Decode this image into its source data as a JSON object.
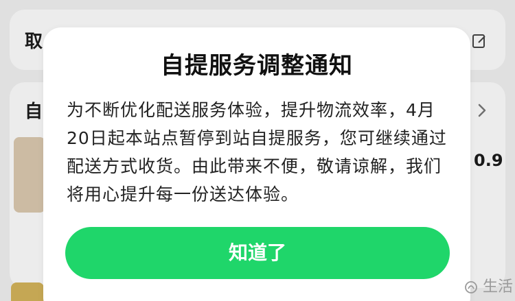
{
  "background": {
    "cancel_label_partial": "取",
    "self_label_partial": "自",
    "price_partial": "0.9",
    "icons": [
      "edit-icon",
      "chevron-right-icon"
    ]
  },
  "modal": {
    "title": "自提服务调整通知",
    "body": "为不断优化配送服务体验，提升物流效率，4月20日起本站点暂停到站自提服务，您可继续通过配送方式收货。由此带来不便，敬请谅解，我们将用心提升每一份送达体验。",
    "confirm_label": "知道了"
  },
  "watermark": {
    "text": "生活"
  },
  "colors": {
    "accent_green": "#1fd66a",
    "modal_bg": "#ffffff",
    "title_text": "#111111",
    "body_text": "#222222",
    "page_bg": "#efefef"
  }
}
